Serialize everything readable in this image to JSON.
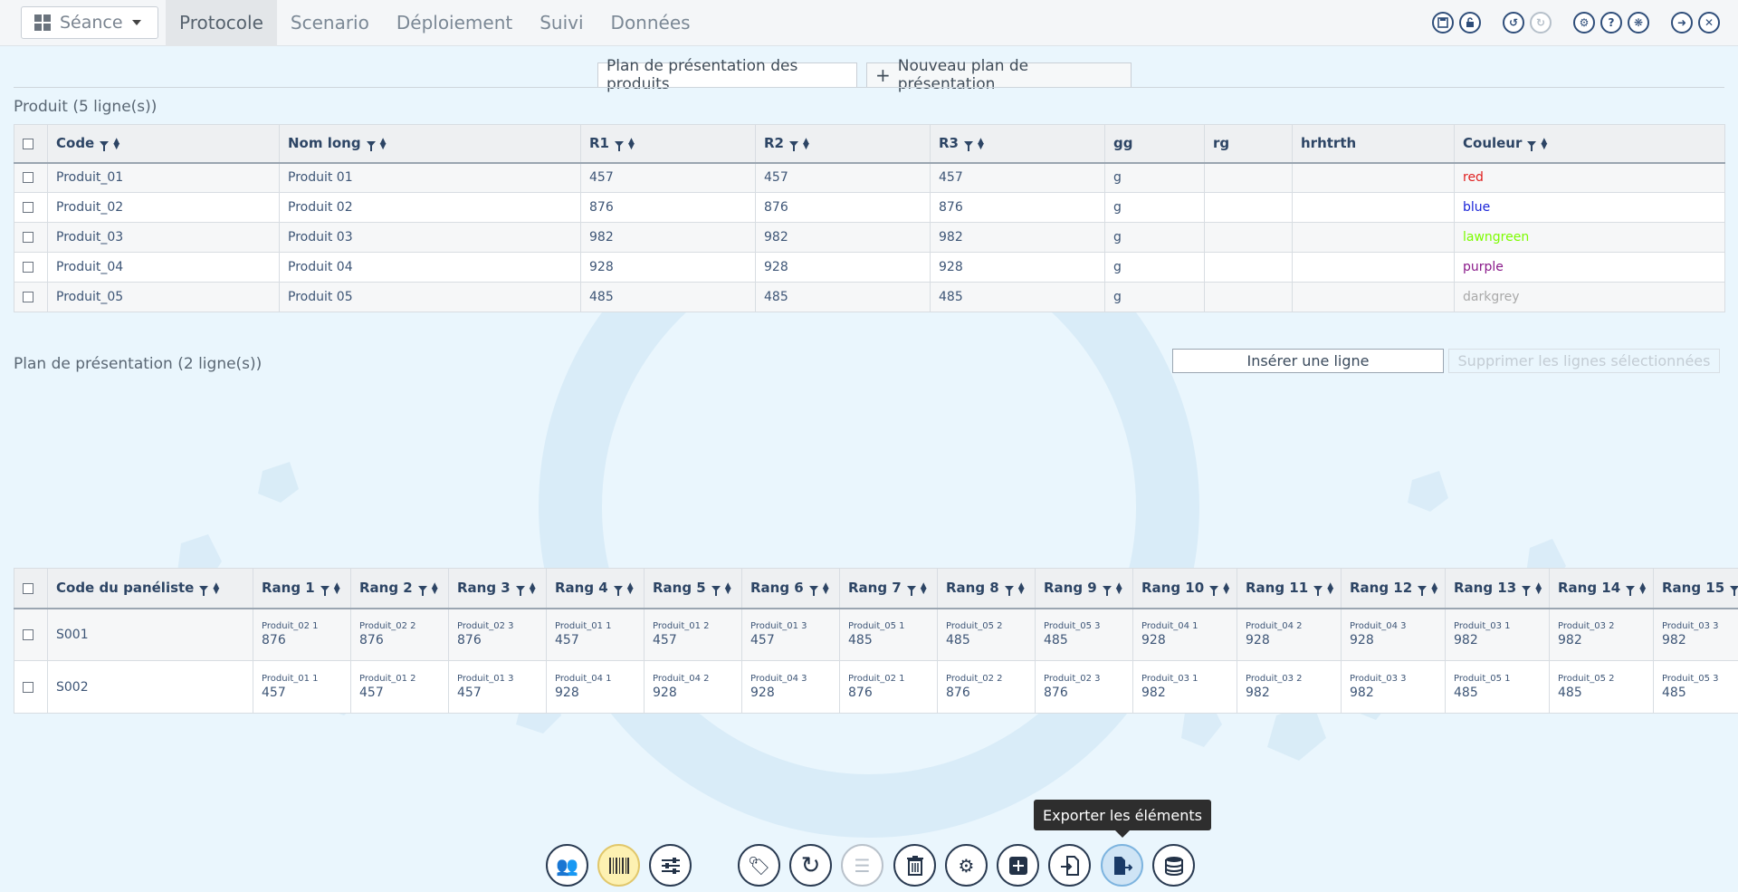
{
  "topnav": {
    "seance_label": "Séance",
    "tabs": [
      "Protocole",
      "Scenario",
      "Déploiement",
      "Suivi",
      "Données"
    ],
    "active_tab": "Protocole",
    "right_icons": [
      "save-icon",
      "unlock-icon",
      "undo-icon",
      "redo-icon",
      "settings-icon",
      "help-icon",
      "bug-icon",
      "logout-icon",
      "close-icon"
    ]
  },
  "plan_tabs": {
    "active": "Plan de présentation des produits",
    "new": "Nouveau plan de présentation"
  },
  "produit": {
    "title": "Produit (5 ligne(s))",
    "columns": [
      "Code",
      "Nom long",
      "R1",
      "R2",
      "R3",
      "gg",
      "rg",
      "hrhtrth",
      "Couleur"
    ],
    "rows": [
      {
        "code": "Produit_01",
        "nom": "Produit 01",
        "r1": "457",
        "r2": "457",
        "r3": "457",
        "gg": "g",
        "rg": "",
        "h": "",
        "couleur": "red"
      },
      {
        "code": "Produit_02",
        "nom": "Produit 02",
        "r1": "876",
        "r2": "876",
        "r3": "876",
        "gg": "g",
        "rg": "",
        "h": "",
        "couleur": "blue"
      },
      {
        "code": "Produit_03",
        "nom": "Produit 03",
        "r1": "982",
        "r2": "982",
        "r3": "982",
        "gg": "g",
        "rg": "",
        "h": "",
        "couleur": "lawngreen"
      },
      {
        "code": "Produit_04",
        "nom": "Produit 04",
        "r1": "928",
        "r2": "928",
        "r3": "928",
        "gg": "g",
        "rg": "",
        "h": "",
        "couleur": "purple"
      },
      {
        "code": "Produit_05",
        "nom": "Produit 05",
        "r1": "485",
        "r2": "485",
        "r3": "485",
        "gg": "g",
        "rg": "",
        "h": "",
        "couleur": "darkgrey"
      }
    ],
    "color_map": {
      "red": "#e02020",
      "blue": "#1a24d8",
      "lawngreen": "#7cfc00",
      "purple": "#8a1a8a",
      "darkgrey": "#a9a9a9"
    }
  },
  "plan": {
    "title": "Plan de présentation (2 ligne(s))",
    "insert_label": "Insérer une ligne",
    "delete_label": "Supprimer les lignes sélectionnées",
    "columns": [
      "Code du panéliste",
      "Rang 1",
      "Rang 2",
      "Rang 3",
      "Rang 4",
      "Rang 5",
      "Rang 6",
      "Rang 7",
      "Rang 8",
      "Rang 9",
      "Rang 10",
      "Rang 11",
      "Rang 12",
      "Rang 13",
      "Rang 14",
      "Rang 15"
    ],
    "rows": [
      {
        "code": "S001",
        "cells": [
          [
            "Produit_02 1",
            "876"
          ],
          [
            "Produit_02 2",
            "876"
          ],
          [
            "Produit_02 3",
            "876"
          ],
          [
            "Produit_01 1",
            "457"
          ],
          [
            "Produit_01 2",
            "457"
          ],
          [
            "Produit_01 3",
            "457"
          ],
          [
            "Produit_05 1",
            "485"
          ],
          [
            "Produit_05 2",
            "485"
          ],
          [
            "Produit_05 3",
            "485"
          ],
          [
            "Produit_04 1",
            "928"
          ],
          [
            "Produit_04 2",
            "928"
          ],
          [
            "Produit_04 3",
            "928"
          ],
          [
            "Produit_03 1",
            "982"
          ],
          [
            "Produit_03 2",
            "982"
          ],
          [
            "Produit_03 3",
            "982"
          ]
        ]
      },
      {
        "code": "S002",
        "cells": [
          [
            "Produit_01 1",
            "457"
          ],
          [
            "Produit_01 2",
            "457"
          ],
          [
            "Produit_01 3",
            "457"
          ],
          [
            "Produit_04 1",
            "928"
          ],
          [
            "Produit_04 2",
            "928"
          ],
          [
            "Produit_04 3",
            "928"
          ],
          [
            "Produit_02 1",
            "876"
          ],
          [
            "Produit_02 2",
            "876"
          ],
          [
            "Produit_02 3",
            "876"
          ],
          [
            "Produit_03 1",
            "982"
          ],
          [
            "Produit_03 2",
            "982"
          ],
          [
            "Produit_03 3",
            "982"
          ],
          [
            "Produit_05 1",
            "485"
          ],
          [
            "Produit_05 2",
            "485"
          ],
          [
            "Produit_05 3",
            "485"
          ]
        ]
      }
    ]
  },
  "toolbar": {
    "tooltip": "Exporter les éléments",
    "buttons": [
      "users-icon",
      "barcode-icon",
      "sliders-icon",
      "tags-icon",
      "refresh-icon",
      "list-icon",
      "trash-icon",
      "cogs-icon",
      "plus-square-icon",
      "import-icon",
      "export-icon",
      "database-icon"
    ]
  }
}
